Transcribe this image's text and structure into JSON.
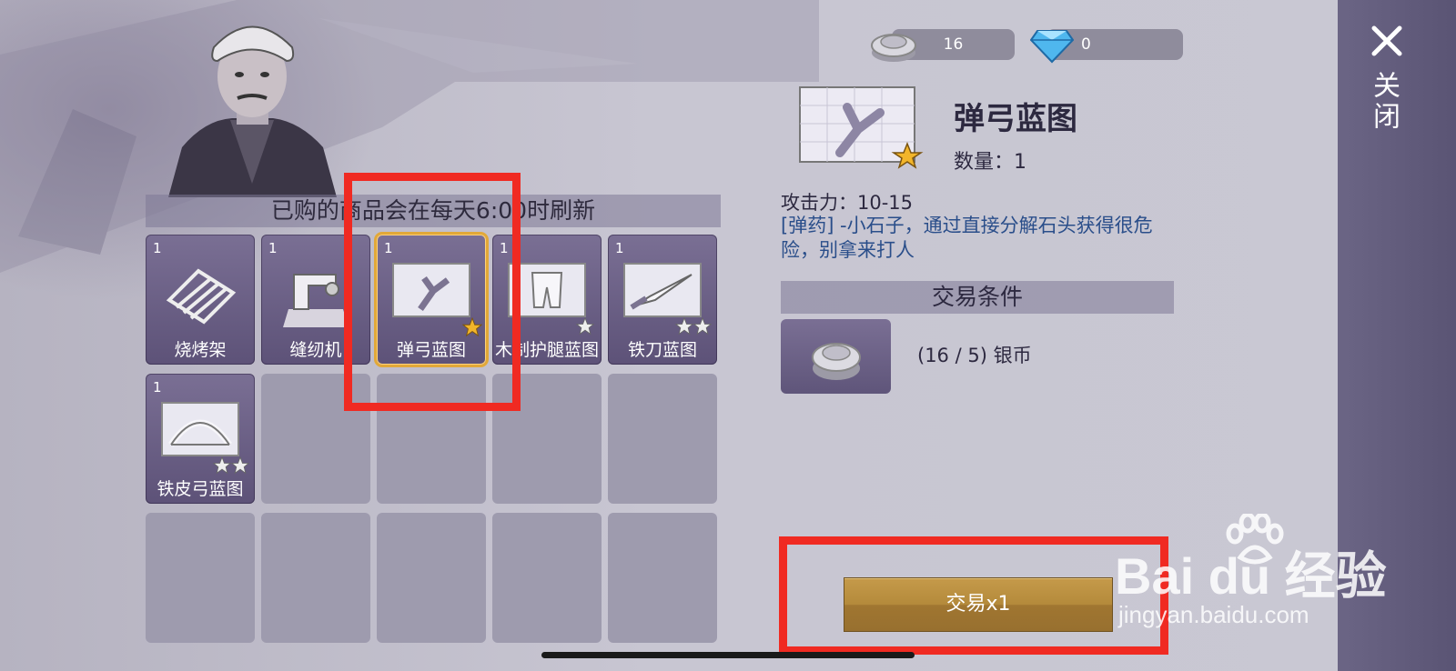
{
  "notice": "已购的商品会在每天6:00时刷新",
  "currency": {
    "silver": "16",
    "diamond": "0"
  },
  "close_label": "关闭",
  "grid": [
    {
      "qty": "1",
      "name": "烧烤架",
      "stars": 0
    },
    {
      "qty": "1",
      "name": "缝纫机",
      "stars": 0
    },
    {
      "qty": "1",
      "name": "弹弓蓝图",
      "stars": 1,
      "selected": true
    },
    {
      "qty": "1",
      "name": "木制护腿蓝图",
      "stars": 1
    },
    {
      "qty": "1",
      "name": "铁刀蓝图",
      "stars": 2
    },
    {
      "qty": "1",
      "name": "铁皮弓蓝图",
      "stars": 2
    }
  ],
  "detail": {
    "title": "弹弓蓝图",
    "quantity": "数量：1",
    "attack": "攻击力：10-15",
    "description": "[弹药] -小石子，通过直接分解石头获得很危险，别拿来打人"
  },
  "trade": {
    "conditions_header": "交易条件",
    "requirement": "(16 / 5) 银币",
    "button_label": "交易x1"
  },
  "watermark": {
    "brand": "Bai du 经验",
    "url": "jingyan.baidu.com"
  },
  "colors": {
    "highlight": "#f02a22",
    "selected_border": "#e2a838",
    "desc_text": "#2a4e8a"
  }
}
